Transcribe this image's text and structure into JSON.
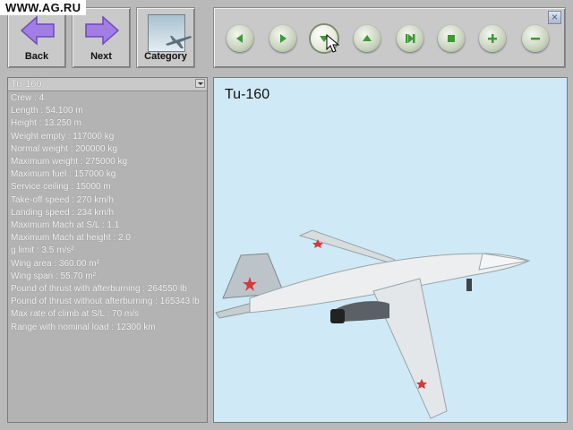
{
  "watermark": "WWW.AG.RU",
  "nav": {
    "back_label": "Back",
    "next_label": "Next",
    "category_label": "Category"
  },
  "controls": [
    {
      "name": "rotate-left"
    },
    {
      "name": "rotate-right"
    },
    {
      "name": "rotate-down"
    },
    {
      "name": "rotate-up"
    },
    {
      "name": "reset"
    },
    {
      "name": "stop"
    },
    {
      "name": "zoom-in"
    },
    {
      "name": "zoom-out"
    }
  ],
  "selected_aircraft": "Tu-160",
  "viewer_title": "Tu-160",
  "specs": [
    "Crew : 4",
    "Length : 54.100 m",
    "Height : 13.250 m",
    "Weight empty : 117000 kg",
    "Normal weight : 200000 kg",
    "Maximum weight : 275000 kg",
    "Maximum fuel : 157000 kg",
    "Service ceiling : 15000 m",
    "Take-off speed : 270 km/h",
    "Landing speed : 234 km/h",
    "Maximum Mach at S/L : 1.1",
    "Maximum Mach at height : 2.0",
    "g limit : 3.5 m/s²",
    "Wing area : 360.00 m²",
    "Wing span : 55.70 m²",
    "Pound of thrust with afterburning : 264550 lb",
    "Pound of thrust without afterburning : 165343 lb",
    "Max rate of climb at S/L : 70 m/s",
    "Range with nominal load : 12300 km"
  ],
  "colors": {
    "arrow_purple": "#a27de6",
    "viewer_bg": "#cfeaf6",
    "control_icon_green": "#3c9a34"
  }
}
